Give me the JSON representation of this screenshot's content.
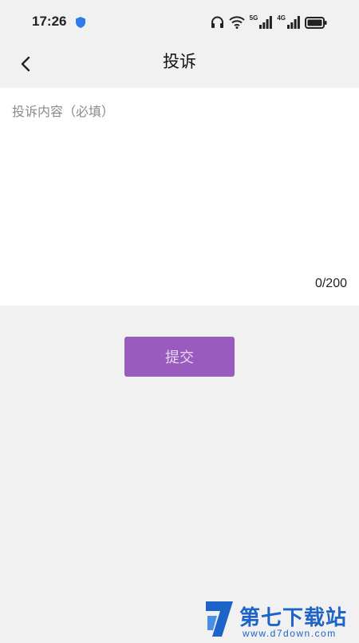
{
  "status_bar": {
    "time": "17:26",
    "network_5g": "5G",
    "network_4g": "4G",
    "icons": [
      "shield-icon",
      "headphones-icon",
      "wifi-icon",
      "signal-icon",
      "battery-icon"
    ]
  },
  "header": {
    "title": "投诉",
    "back_icon": "chevron-left-icon"
  },
  "complaint": {
    "placeholder": "投诉内容（必填）",
    "value": "",
    "counter": "0/200"
  },
  "submit": {
    "label": "提交"
  },
  "watermark": {
    "name": "第七下载站",
    "url": "www.d7down.com"
  },
  "colors": {
    "background": "#f1f1f1",
    "panel": "#ffffff",
    "accent": "#9a5bbf",
    "watermark_blue": "#1e63c8"
  }
}
